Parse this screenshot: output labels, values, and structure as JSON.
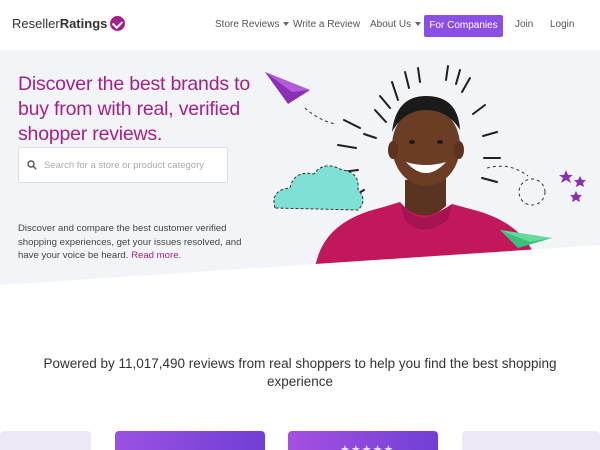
{
  "brand": {
    "name_regular": "Reseller",
    "name_bold": "Ratings",
    "accent": "#a4208d",
    "primary_button": "#8b4fe6"
  },
  "nav": {
    "store_reviews": "Store Reviews",
    "write_review": "Write a Review",
    "about_us": "About Us",
    "for_companies": "For Companies",
    "join": "Join",
    "login": "Login"
  },
  "hero": {
    "headline": "Discover the best brands to buy from with real, verified shopper reviews.",
    "search_placeholder": "Search for a store or product category",
    "description": "Discover and compare the best customer verified shopping experiences, get your issues resolved, and have your voice be heard.",
    "read_more": "Read more."
  },
  "powered": {
    "text": "Powered by 11,017,490 reviews from real shoppers to help you find the best shopping experience"
  },
  "cards": {
    "rating_stars": "★★★★★"
  }
}
